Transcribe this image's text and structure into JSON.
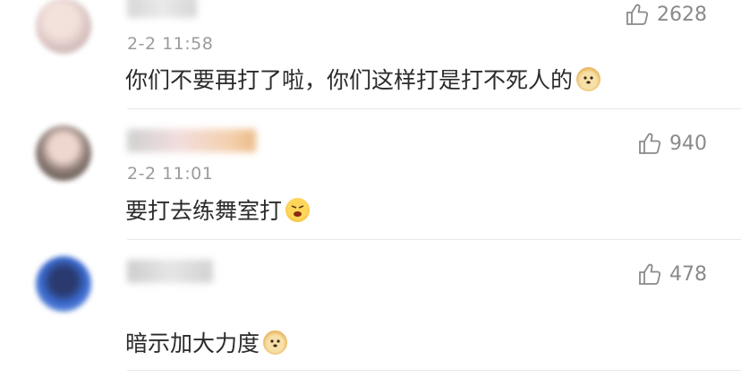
{
  "comments": [
    {
      "time": "2-2 11:58",
      "text": "你们不要再打了啦，你们这样打是打不死人的",
      "emoji": "doge-emoji",
      "likes": "2628"
    },
    {
      "time": "2-2 11:01",
      "text": "要打去练舞室打",
      "emoji": "angry-emoji",
      "likes": "940"
    },
    {
      "time": "",
      "text": "暗示加大力度",
      "emoji": "doge-emoji",
      "likes": "478"
    }
  ]
}
